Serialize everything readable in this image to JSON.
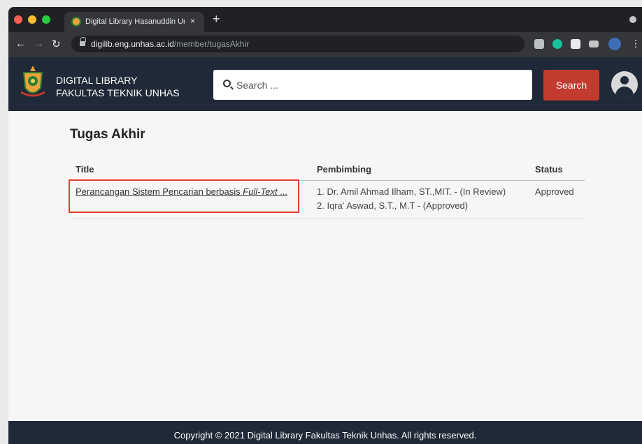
{
  "browser": {
    "tab_title": "Digital Library Hasanuddin Uni",
    "tab_close": "×",
    "new_tab": "+",
    "url_host": "digilib.eng.unhas.ac.id",
    "url_path": "/member/tugasAkhir",
    "icons": [
      "back-icon",
      "forward-icon",
      "reload-icon",
      "lock-icon",
      "star-icon",
      "camera-extension-icon",
      "grammarly-extension-icon",
      "puzzle-extension-icon",
      "reading-list-icon",
      "profile-avatar-icon",
      "more-menu-icon"
    ]
  },
  "header": {
    "brand_line1": "DIGITAL LIBRARY",
    "brand_line2": "FAKULTAS TEKNIK UNHAS",
    "search_placeholder": "Search ...",
    "search_button": "Search"
  },
  "main": {
    "heading": "Tugas Akhir",
    "columns": [
      "Title",
      "Pembimbing",
      "Status"
    ],
    "rows": [
      {
        "title_plain": "Perancangan Sistem Pencarian berbasis ",
        "title_italic": "Full-Text",
        "title_ellipsis": " ...",
        "pembimbing": [
          "1. Dr. Amil Ahmad Ilham, ST.,MIT. - (In Review)",
          "2. Iqra' Aswad, S.T., M.T - (Approved)"
        ],
        "status": "Approved"
      }
    ]
  },
  "footer": {
    "text": "Copyright © 2021 Digital Library Fakultas Teknik Unhas. All rights reserved."
  },
  "colors": {
    "header_bg": "#1f2937",
    "search_button": "#c33a2f",
    "highlight_box": "#e53e2f"
  }
}
